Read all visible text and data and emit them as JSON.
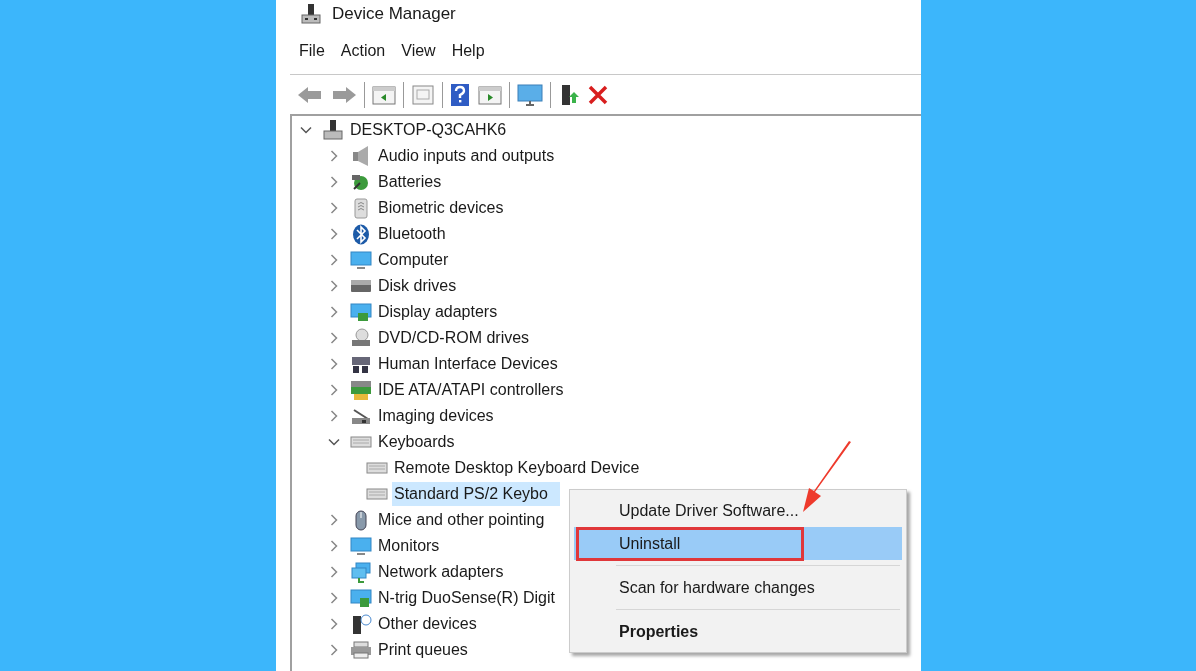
{
  "window": {
    "title": "Device Manager"
  },
  "menu": [
    "File",
    "Action",
    "View",
    "Help"
  ],
  "tree": {
    "label": "DESKTOP-Q3CAHK6",
    "expanded": true,
    "children": [
      {
        "label": "Audio inputs and outputs",
        "expanded": false,
        "selected": false
      },
      {
        "label": "Batteries",
        "expanded": false,
        "selected": false
      },
      {
        "label": "Biometric devices",
        "expanded": false,
        "selected": false
      },
      {
        "label": "Bluetooth",
        "expanded": false,
        "selected": false
      },
      {
        "label": "Computer",
        "expanded": false,
        "selected": false
      },
      {
        "label": "Disk drives",
        "expanded": false,
        "selected": false
      },
      {
        "label": "Display adapters",
        "expanded": false,
        "selected": false
      },
      {
        "label": "DVD/CD-ROM drives",
        "expanded": false,
        "selected": false
      },
      {
        "label": "Human Interface Devices",
        "expanded": false,
        "selected": false
      },
      {
        "label": "IDE ATA/ATAPI controllers",
        "expanded": false,
        "selected": false
      },
      {
        "label": "Imaging devices",
        "expanded": false,
        "selected": false
      },
      {
        "label": "Keyboards",
        "expanded": true,
        "selected": false,
        "children": [
          {
            "label": "Remote Desktop Keyboard Device",
            "selected": false
          },
          {
            "label": "Standard PS/2 Keybo",
            "selected": true
          }
        ]
      },
      {
        "label": "Mice and other pointing",
        "expanded": false,
        "selected": false
      },
      {
        "label": "Monitors",
        "expanded": false,
        "selected": false
      },
      {
        "label": "Network adapters",
        "expanded": false,
        "selected": false
      },
      {
        "label": "N-trig DuoSense(R) Digit",
        "expanded": false,
        "selected": false
      },
      {
        "label": "Other devices",
        "expanded": false,
        "selected": false
      },
      {
        "label": "Print queues",
        "expanded": false,
        "selected": false
      }
    ]
  },
  "context_menu": [
    {
      "kind": "item",
      "label": "Update Driver Software...",
      "highlighted": false,
      "bold": false
    },
    {
      "kind": "item",
      "label": "Uninstall",
      "highlighted": true,
      "bold": false
    },
    {
      "kind": "separator"
    },
    {
      "kind": "item",
      "label": "Scan for hardware changes",
      "highlighted": false,
      "bold": false
    },
    {
      "kind": "separator"
    },
    {
      "kind": "item",
      "label": "Properties",
      "highlighted": false,
      "bold": true
    }
  ]
}
